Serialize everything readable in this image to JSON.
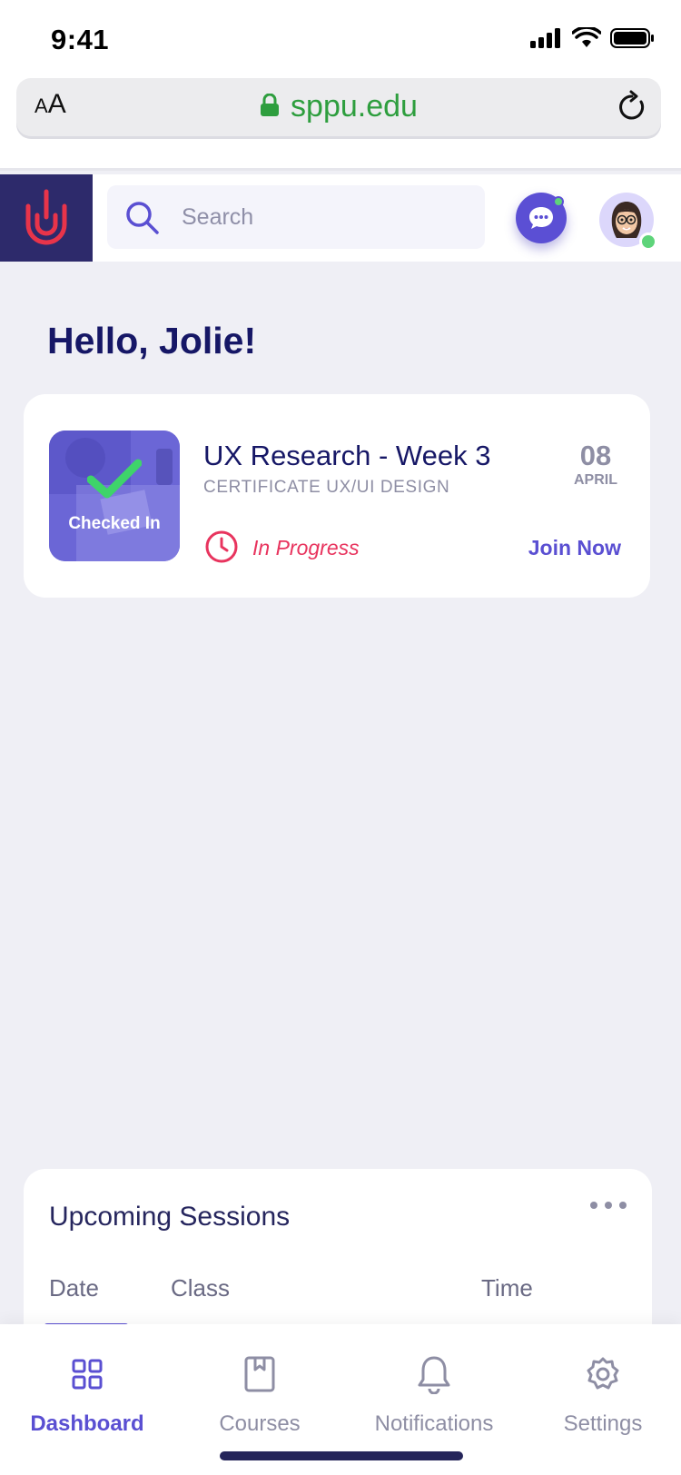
{
  "status_bar": {
    "time": "9:41"
  },
  "browser": {
    "aa_label_small": "A",
    "aa_label_large": "A",
    "url": "sppu.edu"
  },
  "header": {
    "search_placeholder": "Search"
  },
  "greeting": "Hello, Jolie!",
  "session_card": {
    "thumbnail_label": "Checked In",
    "title": "UX Research - Week 3",
    "subtitle": "CERTIFICATE UX/UI DESIGN",
    "day": "08",
    "month": "APRIL",
    "status": "In Progress",
    "action_label": "Join Now"
  },
  "upcoming": {
    "title": "Upcoming Sessions",
    "columns": [
      "Date",
      "Class",
      "Time"
    ]
  },
  "bottom_nav": {
    "items": [
      {
        "label": "Dashboard",
        "icon": "grid-icon",
        "active": true
      },
      {
        "label": "Courses",
        "icon": "book-icon",
        "active": false
      },
      {
        "label": "Notifications",
        "icon": "bell-icon",
        "active": false
      },
      {
        "label": "Settings",
        "icon": "gear-icon",
        "active": false
      }
    ]
  },
  "colors": {
    "accent": "#5a4fd2",
    "logo_bg": "#2d2a6b",
    "status_red": "#e8345e",
    "online_green": "#5ed47a",
    "url_green": "#2e9e3e"
  }
}
